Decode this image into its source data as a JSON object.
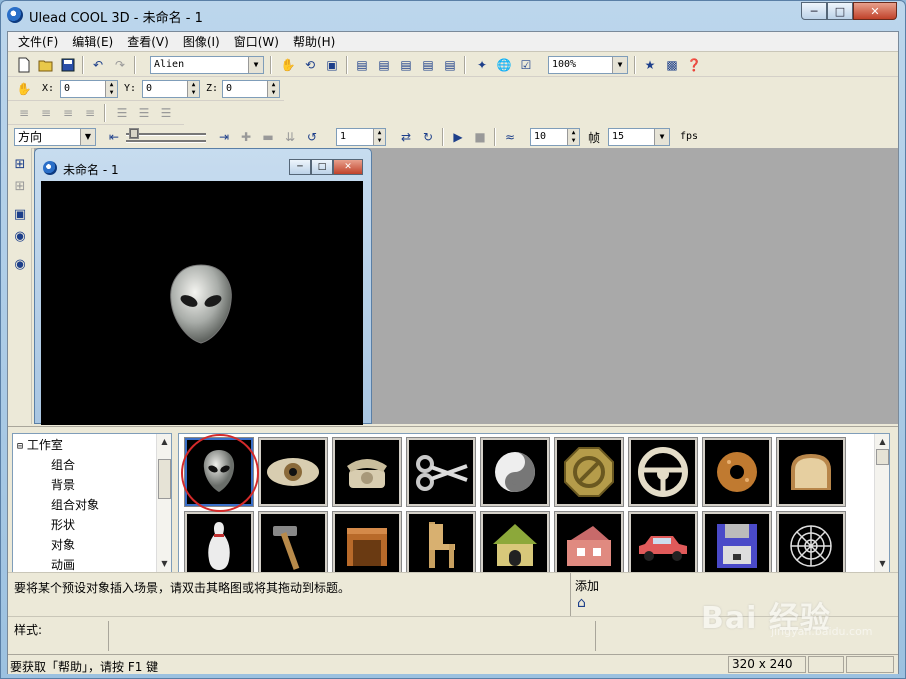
{
  "window": {
    "title": "Ulead COOL 3D - 未命名 - 1"
  },
  "menubar": [
    "文件(F)",
    "编辑(E)",
    "查看(V)",
    "图像(I)",
    "窗口(W)",
    "帮助(H)"
  ],
  "toolbar1": {
    "font_value": "Alien",
    "zoom_value": "100%"
  },
  "toolbar2": {
    "x_label": "X:",
    "x_value": "0",
    "y_label": "Y:",
    "y_value": "0",
    "z_label": "Z:",
    "z_value": "0"
  },
  "toolbar4": {
    "direction_value": "方向",
    "frame_value": "1",
    "speed_value": "10",
    "frames_label": "帧",
    "fps_value": "15",
    "fps_label": "fps"
  },
  "document": {
    "title": "未命名 - 1"
  },
  "tree": {
    "root": "工作室",
    "children": [
      "组合",
      "背景",
      "组合对象",
      "形状",
      "对象",
      "动画"
    ]
  },
  "gallery": {
    "row1": [
      "alien",
      "eye",
      "telephone",
      "scissors",
      "yin-yang",
      "no-sign",
      "steering-wheel",
      "donut",
      "bread"
    ],
    "row2": [
      "bowling-pin",
      "hammer",
      "box",
      "chair",
      "doghouse",
      "house",
      "car",
      "floppy-disk",
      "spider-web"
    ],
    "selected_index": 0
  },
  "hint": {
    "text": "要将某个预设对象插入场景，请双击其略图或将其拖动到标题。",
    "add_label": "添加"
  },
  "style": {
    "label": "样式:"
  },
  "status": {
    "text": "要获取「帮助」，请按 F1 键",
    "size": "320 x 240"
  },
  "watermark": {
    "text": "Bai 经验",
    "url": "jingyan.baidu.com"
  },
  "colors": {
    "accent": "#3a6fc8",
    "highlight_ring": "#d42a2a",
    "canvas_bg": "#000000",
    "workspace_bg": "#a9a9a9"
  }
}
